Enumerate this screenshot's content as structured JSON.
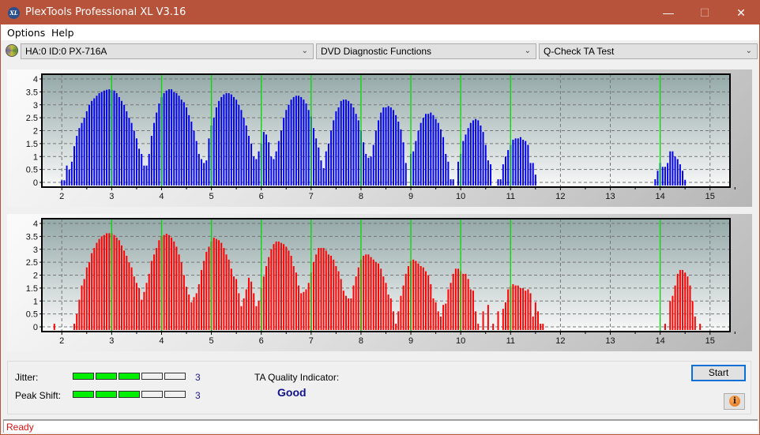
{
  "window": {
    "title": "PlexTools Professional XL V3.16",
    "app_icon": "XL",
    "controls": {
      "minimize": "—",
      "maximize": "☐",
      "close": "✕"
    },
    "titlebar_color": "#b7533a"
  },
  "menu": {
    "items": [
      "Options",
      "Help"
    ]
  },
  "toolbar": {
    "drive": "HA:0 ID:0  PX-716A",
    "function": "DVD Diagnostic Functions",
    "test": "Q-Check TA Test"
  },
  "results": {
    "jitter_label": "Jitter:",
    "jitter_value": "3",
    "jitter_level": 3,
    "jitter_max": 5,
    "peak_shift_label": "Peak Shift:",
    "peak_shift_value": "3",
    "peak_shift_level": 3,
    "peak_shift_max": 5,
    "ta_label": "TA Quality Indicator:",
    "ta_value": "Good",
    "start_label": "Start",
    "info_icon": "i"
  },
  "status": {
    "text": "Ready"
  },
  "chart_data": [
    {
      "type": "bar",
      "name": "TA histogram (top / blue)",
      "color": "#0000ee",
      "marker_color": "#00dd00",
      "xlim": [
        1.6,
        15.4
      ],
      "ylim": [
        0,
        4.2
      ],
      "xticks": [
        "2",
        "3",
        "4",
        "5",
        "6",
        "7",
        "8",
        "9",
        "10",
        "11",
        "12",
        "13",
        "14",
        "15"
      ],
      "yticks": [
        "0",
        "0.5",
        "1",
        "1.5",
        "2",
        "2.5",
        "3",
        "3.5",
        "4"
      ],
      "markers": [
        3,
        4,
        5,
        6,
        7,
        8,
        9,
        10,
        11,
        14
      ],
      "grid": true,
      "x_start": 1.6,
      "x_step": 0.05,
      "values": [
        0.1,
        0,
        0,
        0,
        0,
        0,
        0,
        0,
        0.08,
        0.08,
        0.65,
        0.5,
        0.8,
        1.4,
        1.8,
        2.1,
        2.3,
        2.5,
        2.75,
        3.0,
        3.15,
        3.25,
        3.35,
        3.45,
        3.5,
        3.55,
        3.58,
        3.6,
        3.58,
        3.55,
        3.45,
        3.3,
        3.15,
        3.0,
        2.75,
        2.5,
        2.3,
        2.0,
        1.7,
        1.3,
        1.1,
        0.65,
        0.65,
        1.1,
        1.8,
        2.3,
        2.7,
        3.05,
        3.3,
        3.45,
        3.55,
        3.6,
        3.6,
        3.5,
        3.45,
        3.35,
        3.2,
        3.1,
        2.9,
        2.6,
        2.35,
        2.0,
        1.6,
        1.1,
        0.9,
        0.75,
        0.85,
        1.7,
        2.2,
        2.5,
        2.9,
        3.15,
        3.3,
        3.4,
        3.45,
        3.45,
        3.4,
        3.3,
        3.2,
        3.0,
        2.8,
        2.5,
        2.2,
        1.8,
        1.5,
        1.0,
        0.9,
        1.2,
        1.5,
        1.95,
        1.85,
        1.55,
        1.0,
        0.9,
        1.2,
        1.6,
        2.0,
        2.5,
        2.8,
        3.0,
        3.2,
        3.3,
        3.35,
        3.35,
        3.3,
        3.2,
        3.05,
        2.8,
        2.55,
        2.1,
        1.7,
        1.35,
        0.85,
        0.55,
        1.2,
        1.5,
        2.0,
        2.4,
        2.75,
        2.9,
        3.15,
        3.2,
        3.2,
        3.15,
        3.05,
        2.9,
        2.65,
        2.4,
        2.0,
        1.55,
        1.1,
        0.95,
        1.0,
        1.45,
        2.0,
        2.4,
        2.7,
        2.9,
        2.9,
        2.95,
        2.9,
        2.8,
        2.6,
        2.35,
        2.05,
        1.55,
        0.75,
        0,
        1.1,
        1.2,
        1.6,
        2.0,
        2.3,
        2.5,
        2.65,
        2.65,
        2.7,
        2.6,
        2.45,
        2.3,
        2.05,
        1.75,
        1.1,
        0.8,
        0.12,
        0.12,
        0,
        0.8,
        1.1,
        1.6,
        1.85,
        2.1,
        2.3,
        2.4,
        2.45,
        2.4,
        2.2,
        1.95,
        1.45,
        0.85,
        0.7,
        0,
        0,
        0.12,
        0.12,
        0.7,
        1.0,
        1.25,
        1.45,
        1.65,
        1.7,
        1.7,
        1.75,
        1.65,
        1.6,
        1.45,
        0.75,
        0.75,
        0.3,
        0,
        0,
        0,
        0,
        0,
        0,
        0,
        0,
        0,
        0,
        0,
        0,
        0,
        0,
        0,
        0,
        0,
        0,
        0,
        0,
        0,
        0,
        0,
        0,
        0,
        0,
        0,
        0,
        0,
        0,
        0,
        0,
        0,
        0,
        0,
        0,
        0,
        0,
        0,
        0,
        0,
        0,
        0,
        0,
        0,
        0,
        0,
        0.12,
        0.45,
        0.75,
        0.6,
        0.6,
        0.75,
        1.2,
        1.2,
        1.0,
        0.9,
        0.7,
        0.45,
        0.1
      ]
    },
    {
      "type": "bar",
      "name": "TA histogram (bottom / red)",
      "color": "#ff0000",
      "marker_color": "#00dd00",
      "xlim": [
        1.6,
        15.4
      ],
      "ylim": [
        0,
        4.2
      ],
      "xticks": [
        "2",
        "3",
        "4",
        "5",
        "6",
        "7",
        "8",
        "9",
        "10",
        "11",
        "12",
        "13",
        "14",
        "15"
      ],
      "yticks": [
        "0",
        "0.5",
        "1",
        "1.5",
        "2",
        "2.5",
        "3",
        "3.5",
        "4"
      ],
      "markers": [
        3,
        4,
        5,
        6,
        7,
        8,
        9,
        10,
        11,
        14
      ],
      "grid": true,
      "x_start": 1.6,
      "x_step": 0.05,
      "values": [
        0,
        0,
        0,
        0,
        0,
        0.12,
        0,
        0,
        0,
        0,
        0,
        0,
        0,
        0.12,
        0.5,
        1.05,
        1.6,
        1.85,
        2.3,
        2.5,
        2.85,
        3.05,
        3.25,
        3.4,
        3.5,
        3.55,
        3.62,
        3.62,
        3.62,
        3.55,
        3.45,
        3.35,
        3.15,
        2.95,
        2.75,
        2.5,
        2.3,
        1.95,
        1.7,
        1.5,
        1.05,
        1.35,
        1.7,
        2.05,
        2.55,
        2.8,
        3.05,
        3.35,
        3.5,
        3.55,
        3.6,
        3.55,
        3.45,
        3.3,
        3.1,
        2.8,
        2.5,
        2.0,
        1.55,
        1.25,
        0.95,
        1.15,
        1.3,
        1.65,
        2.2,
        2.55,
        2.9,
        3.1,
        3.3,
        3.45,
        3.4,
        3.35,
        3.25,
        3.05,
        2.8,
        2.6,
        2.25,
        1.95,
        1.85,
        1.3,
        0.8,
        1.1,
        1.45,
        1.9,
        1.75,
        1.3,
        0.8,
        1.0,
        1.5,
        1.95,
        2.35,
        2.7,
        3.0,
        3.2,
        3.3,
        3.3,
        3.25,
        3.2,
        3.1,
        2.95,
        2.75,
        2.35,
        2.1,
        1.6,
        1.3,
        1.35,
        1.45,
        1.7,
        2.1,
        2.5,
        2.8,
        3.05,
        3.05,
        3.05,
        2.95,
        2.8,
        2.75,
        2.6,
        2.35,
        2.15,
        1.85,
        1.4,
        1.2,
        1.1,
        1.1,
        1.6,
        1.95,
        2.3,
        2.6,
        2.75,
        2.8,
        2.8,
        2.7,
        2.6,
        2.5,
        2.45,
        2.25,
        1.95,
        1.7,
        1.25,
        1.1,
        0.6,
        0.12,
        0.6,
        1.2,
        1.6,
        2.05,
        2.35,
        2.55,
        2.6,
        2.55,
        2.45,
        2.35,
        2.3,
        2.15,
        2.0,
        1.65,
        1.1,
        0.95,
        0.6,
        0.4,
        0.85,
        0.9,
        1.45,
        1.7,
        2.05,
        2.25,
        2.25,
        2.15,
        2.05,
        2.05,
        1.85,
        1.45,
        1.4,
        0.6,
        0.12,
        0,
        0.6,
        0,
        0.85,
        0,
        0.12,
        0,
        0.6,
        0,
        0.7,
        0.95,
        1.45,
        1.55,
        1.65,
        1.6,
        1.6,
        1.5,
        1.5,
        1.4,
        1.45,
        1.3,
        0.4,
        0.95,
        0.6,
        0.12,
        0.12,
        0,
        0,
        0,
        0,
        0,
        0,
        0,
        0,
        0,
        0,
        0,
        0,
        0,
        0,
        0,
        0,
        0,
        0,
        0,
        0,
        0,
        0,
        0,
        0,
        0,
        0,
        0,
        0,
        0,
        0,
        0,
        0,
        0,
        0,
        0,
        0,
        0,
        0,
        0,
        0,
        0,
        0,
        0,
        0,
        0,
        0,
        0,
        0,
        0.12,
        0,
        1.0,
        1.2,
        1.6,
        2.05,
        2.2,
        2.2,
        2.1,
        1.95,
        1.6,
        1.0,
        0.4,
        0,
        0.12
      ]
    }
  ]
}
